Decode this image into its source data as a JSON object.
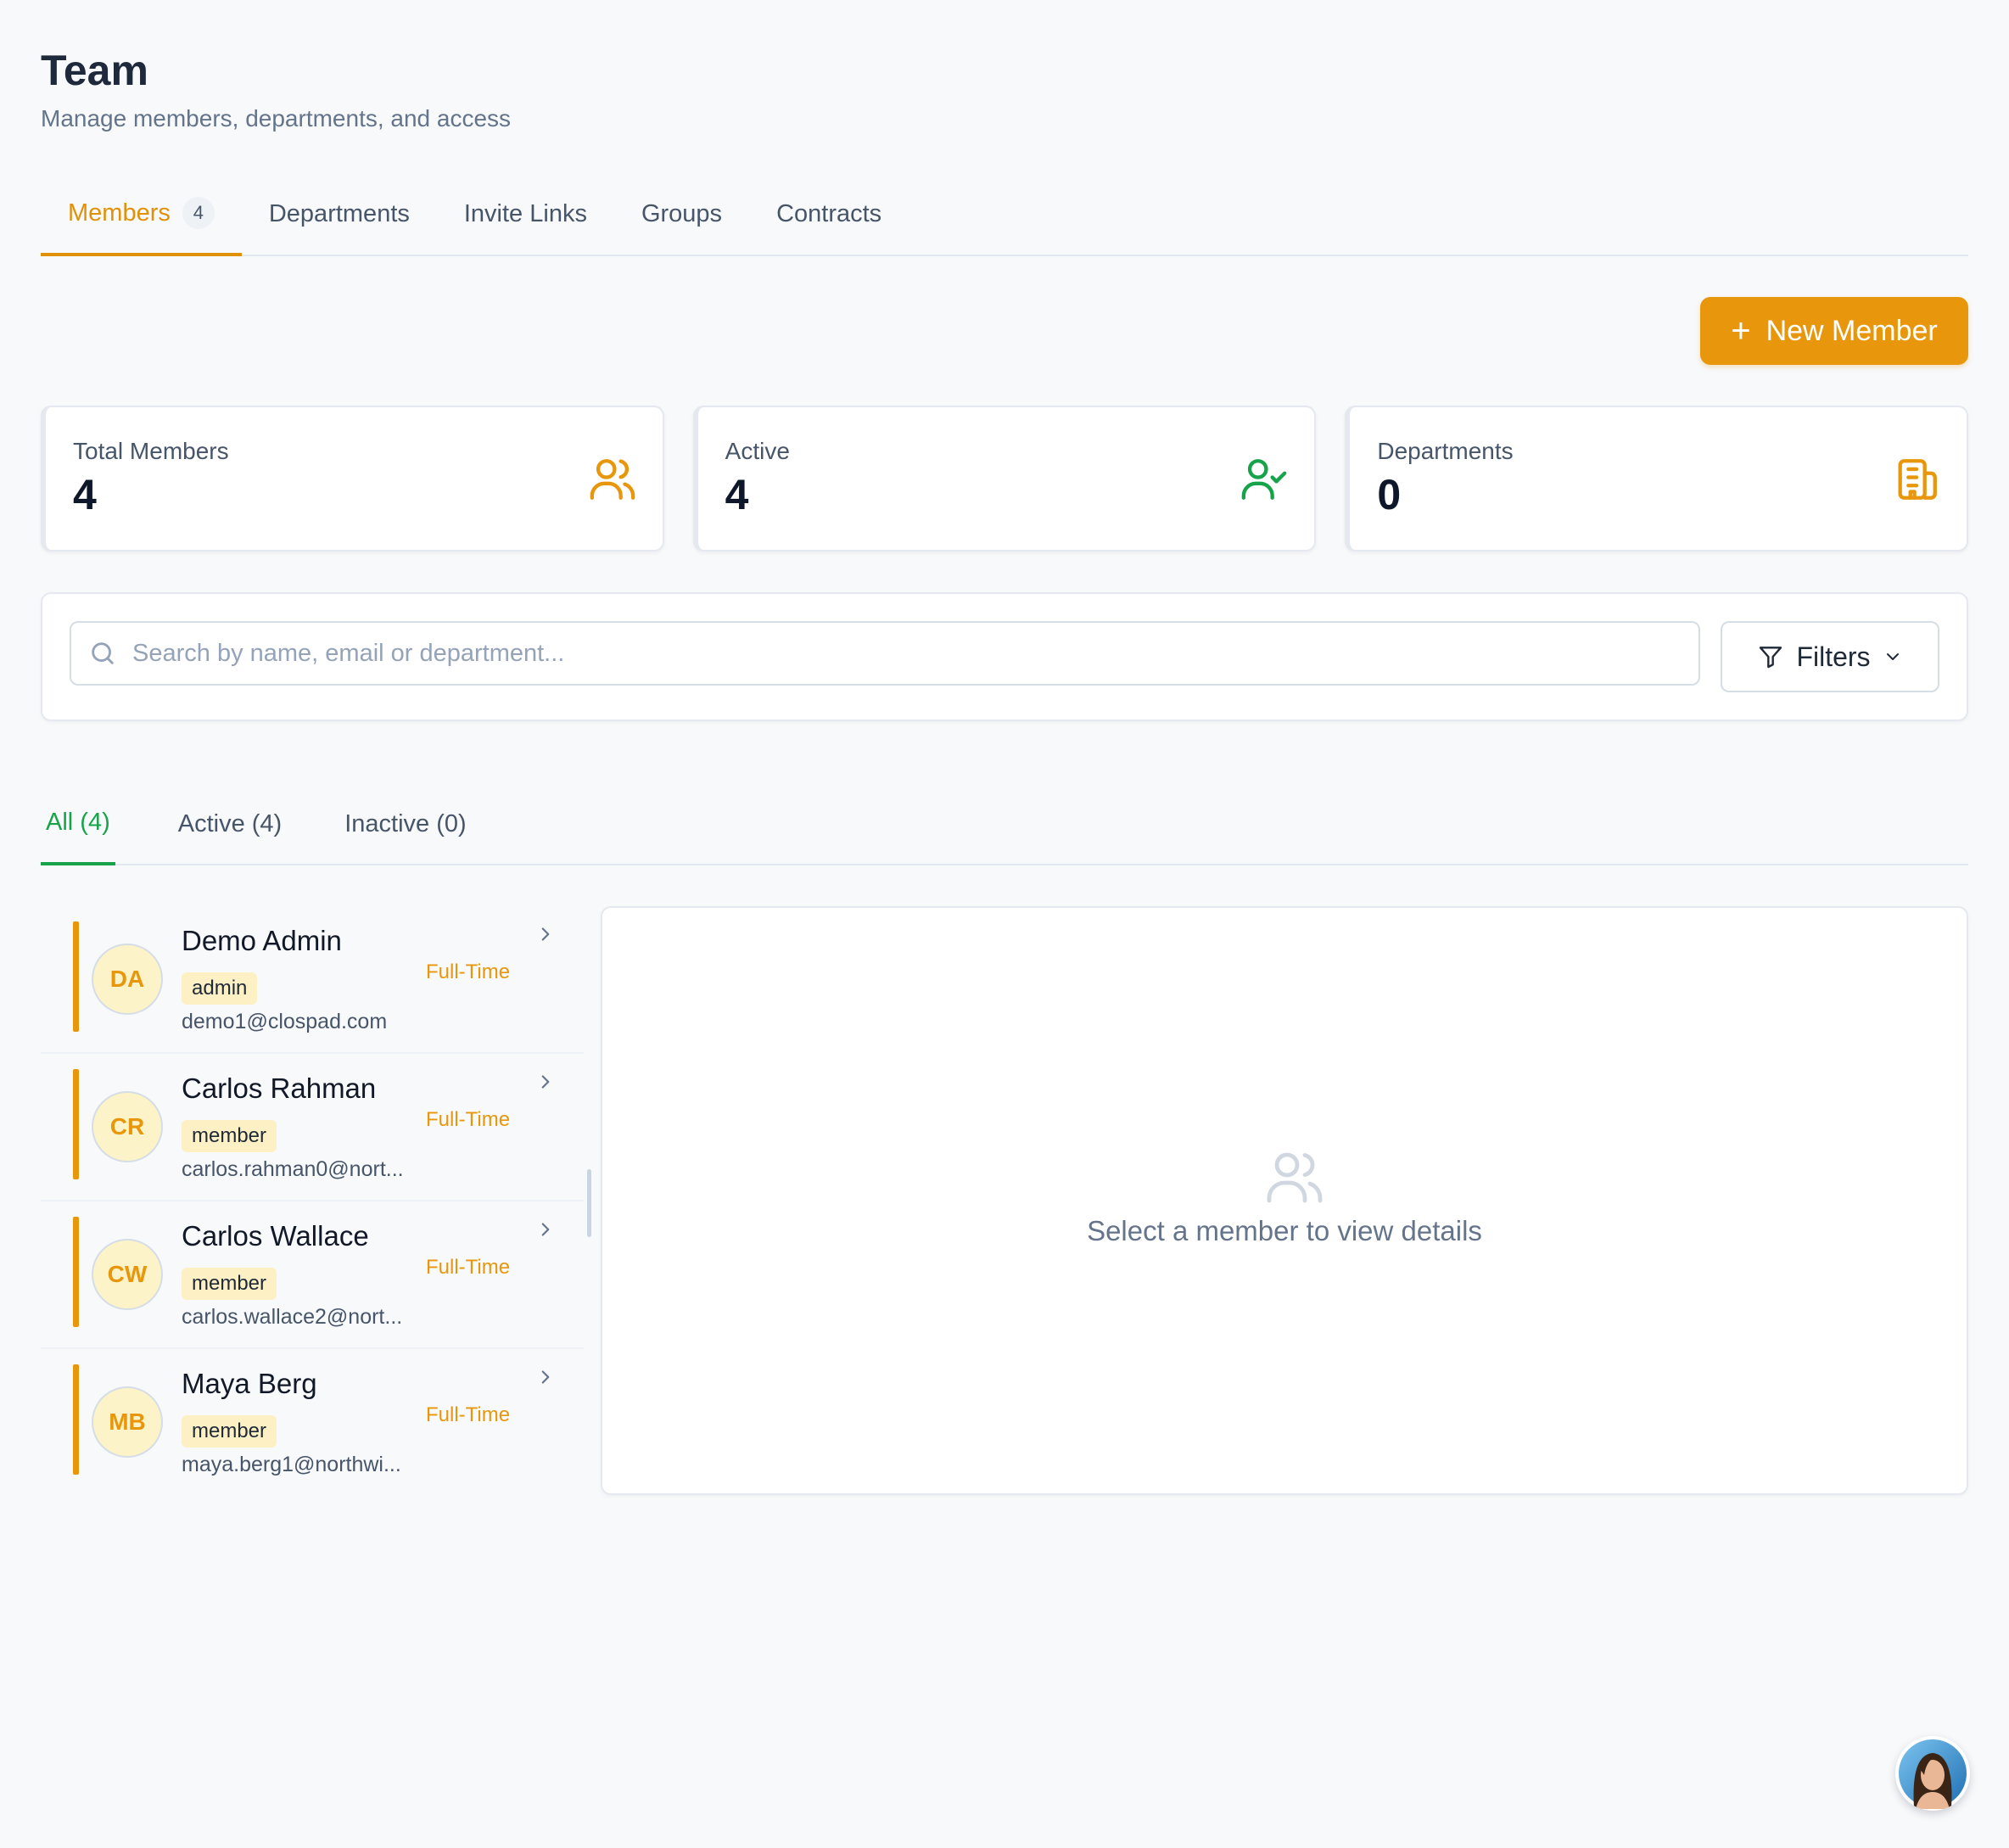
{
  "header": {
    "title": "Team",
    "subtitle": "Manage members, departments, and access"
  },
  "tabs": [
    {
      "label": "Members",
      "count": "4",
      "active": true
    },
    {
      "label": "Departments"
    },
    {
      "label": "Invite Links"
    },
    {
      "label": "Groups"
    },
    {
      "label": "Contracts"
    }
  ],
  "actions": {
    "new_member_label": "New Member",
    "new_member_icon": "plus-icon"
  },
  "stats": [
    {
      "label": "Total Members",
      "value": "4",
      "icon": "users-icon",
      "color": "#e8970c"
    },
    {
      "label": "Active",
      "value": "4",
      "icon": "user-check-icon",
      "color": "#16a34a"
    },
    {
      "label": "Departments",
      "value": "0",
      "icon": "building-icon",
      "color": "#e8970c"
    }
  ],
  "search": {
    "placeholder": "Search by name, email or department...",
    "value": "",
    "filters_label": "Filters"
  },
  "subtabs": [
    {
      "label": "All (4)",
      "active": true
    },
    {
      "label": "Active (4)"
    },
    {
      "label": "Inactive (0)"
    }
  ],
  "members": [
    {
      "initials": "DA",
      "name": "Demo Admin",
      "role": "admin",
      "email": "demo1@clospad.com",
      "type": "Full-Time"
    },
    {
      "initials": "CR",
      "name": "Carlos Rahman",
      "role": "member",
      "email": "carlos.rahman0@nort...",
      "type": "Full-Time"
    },
    {
      "initials": "CW",
      "name": "Carlos Wallace",
      "role": "member",
      "email": "carlos.wallace2@nort...",
      "type": "Full-Time"
    },
    {
      "initials": "MB",
      "name": "Maya Berg",
      "role": "member",
      "email": "maya.berg1@northwi...",
      "type": "Full-Time"
    }
  ],
  "details": {
    "empty_text": "Select a member to view details"
  },
  "colors": {
    "accent": "#e8970c",
    "success": "#16a34a",
    "background": "#f8f9fb"
  }
}
